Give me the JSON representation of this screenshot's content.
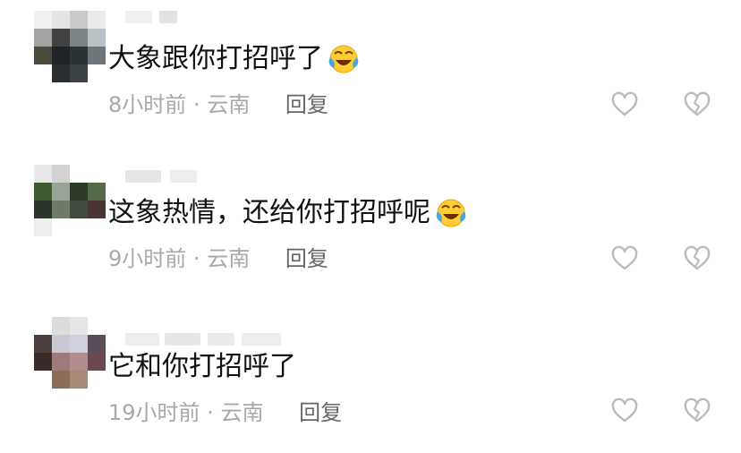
{
  "comments": [
    {
      "text": "大象跟你打招呼了",
      "time": "8小时前",
      "separator": "·",
      "location": "云南",
      "reply_label": "回复",
      "emoji": "laughing-crying-face",
      "like_icon": "heart-outline-icon",
      "dislike_icon": "broken-heart-icon"
    },
    {
      "text": "这象热情，还给你打招呼呢",
      "time": "9小时前",
      "separator": "·",
      "location": "云南",
      "reply_label": "回复",
      "emoji": "laughing-crying-face",
      "like_icon": "heart-outline-icon",
      "dislike_icon": "broken-heart-icon"
    },
    {
      "text": "它和你打招呼了",
      "time": "19小时前",
      "separator": "·",
      "location": "云南",
      "reply_label": "回复",
      "like_icon": "heart-outline-icon",
      "dislike_icon": "broken-heart-icon"
    }
  ],
  "colors": {
    "text": "#111111",
    "meta": "#a8a8a8",
    "reply": "#666666",
    "icon": "#bbbbbb",
    "emoji_yellow": "#ffcc33",
    "emoji_tear": "#4aa3e0"
  }
}
